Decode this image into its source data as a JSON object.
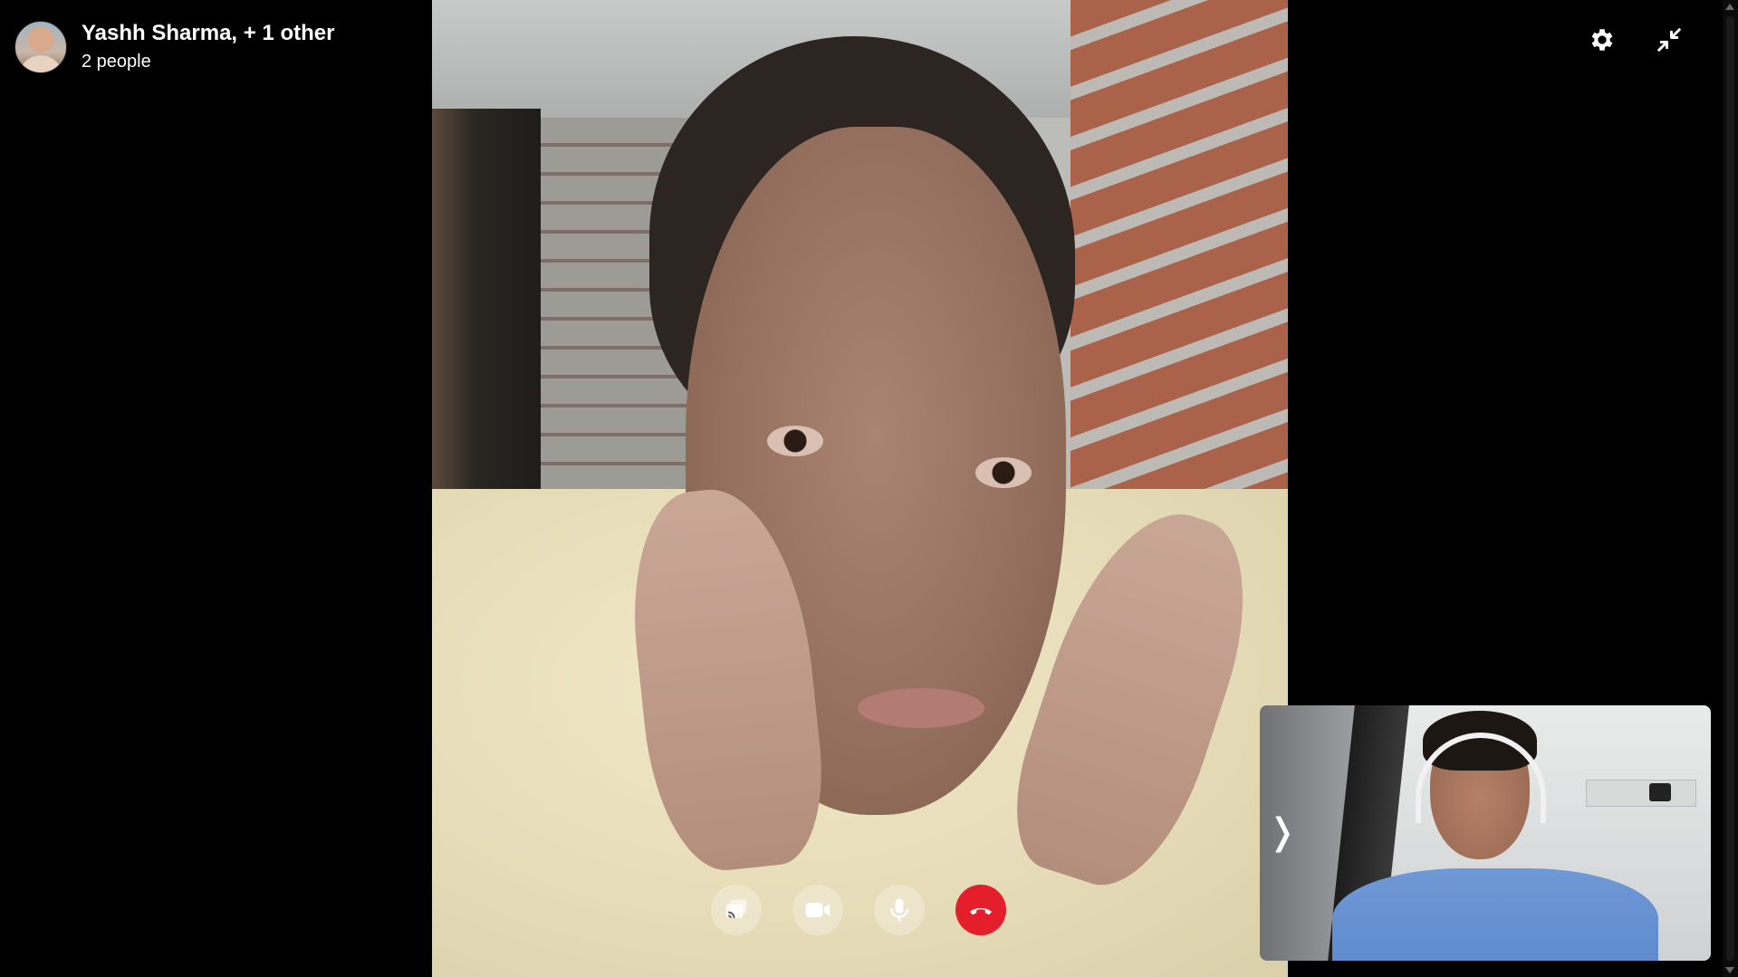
{
  "header": {
    "title": "Yashh Sharma, + 1 other",
    "subtitle": "2 people"
  },
  "top_controls": {
    "settings_icon": "gear-icon",
    "minimize_icon": "minimize-arrows-icon"
  },
  "call_controls": [
    {
      "name": "screen-share-button",
      "icon": "screen-share-icon"
    },
    {
      "name": "camera-button",
      "icon": "video-camera-icon"
    },
    {
      "name": "microphone-button",
      "icon": "microphone-icon"
    },
    {
      "name": "end-call-button",
      "icon": "phone-hangup-icon",
      "color": "#e41e2b"
    }
  ],
  "self_view": {
    "collapse_glyph": "❭"
  }
}
